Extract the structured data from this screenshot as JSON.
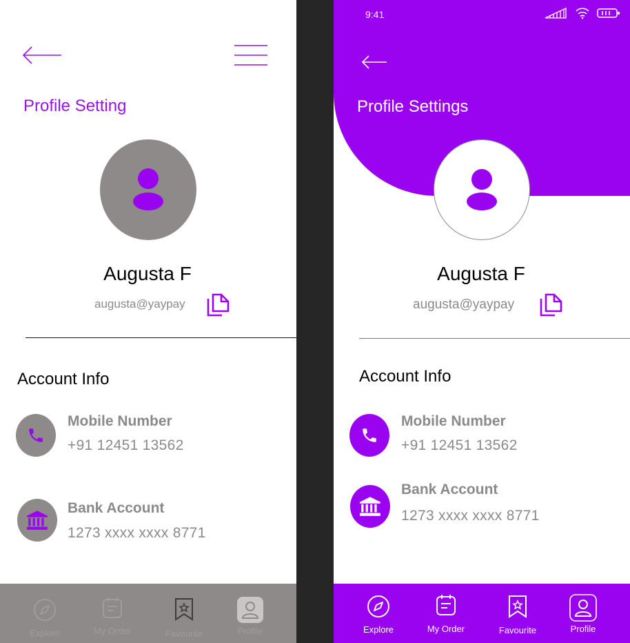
{
  "colors": {
    "accent": "#9a03f0",
    "grey": "#8e8a8a",
    "text_muted": "#8a8a8a",
    "gutter": "#262626"
  },
  "left": {
    "title": "Profile Setting",
    "user": {
      "name": "Augusta F",
      "email": "augusta@yaypay"
    },
    "account_info": {
      "heading": "Account Info",
      "mobile": {
        "label": "Mobile Number",
        "value": "+91 12451 13562"
      },
      "bank": {
        "label": "Bank Account",
        "value": "1273 xxxx xxxx 8771"
      }
    },
    "nav": [
      {
        "label": "Explore",
        "icon": "compass-icon"
      },
      {
        "label": "My Order",
        "icon": "order-icon"
      },
      {
        "label": "Favourite",
        "icon": "bookmark-icon"
      },
      {
        "label": "Profile",
        "icon": "profile-icon"
      }
    ]
  },
  "right": {
    "status": {
      "time": "9:41"
    },
    "title": "Profile Settings",
    "user": {
      "name": "Augusta F",
      "email": "augusta@yaypay"
    },
    "account_info": {
      "heading": "Account Info",
      "mobile": {
        "label": "Mobile Number",
        "value": "+91 12451 13562"
      },
      "bank": {
        "label": "Bank Account",
        "value": "1273 xxxx xxxx 8771"
      }
    },
    "nav": [
      {
        "label": "Explore",
        "icon": "compass-icon"
      },
      {
        "label": "My Order",
        "icon": "order-icon"
      },
      {
        "label": "Favourite",
        "icon": "bookmark-icon"
      },
      {
        "label": "Profile",
        "icon": "profile-icon"
      }
    ]
  }
}
